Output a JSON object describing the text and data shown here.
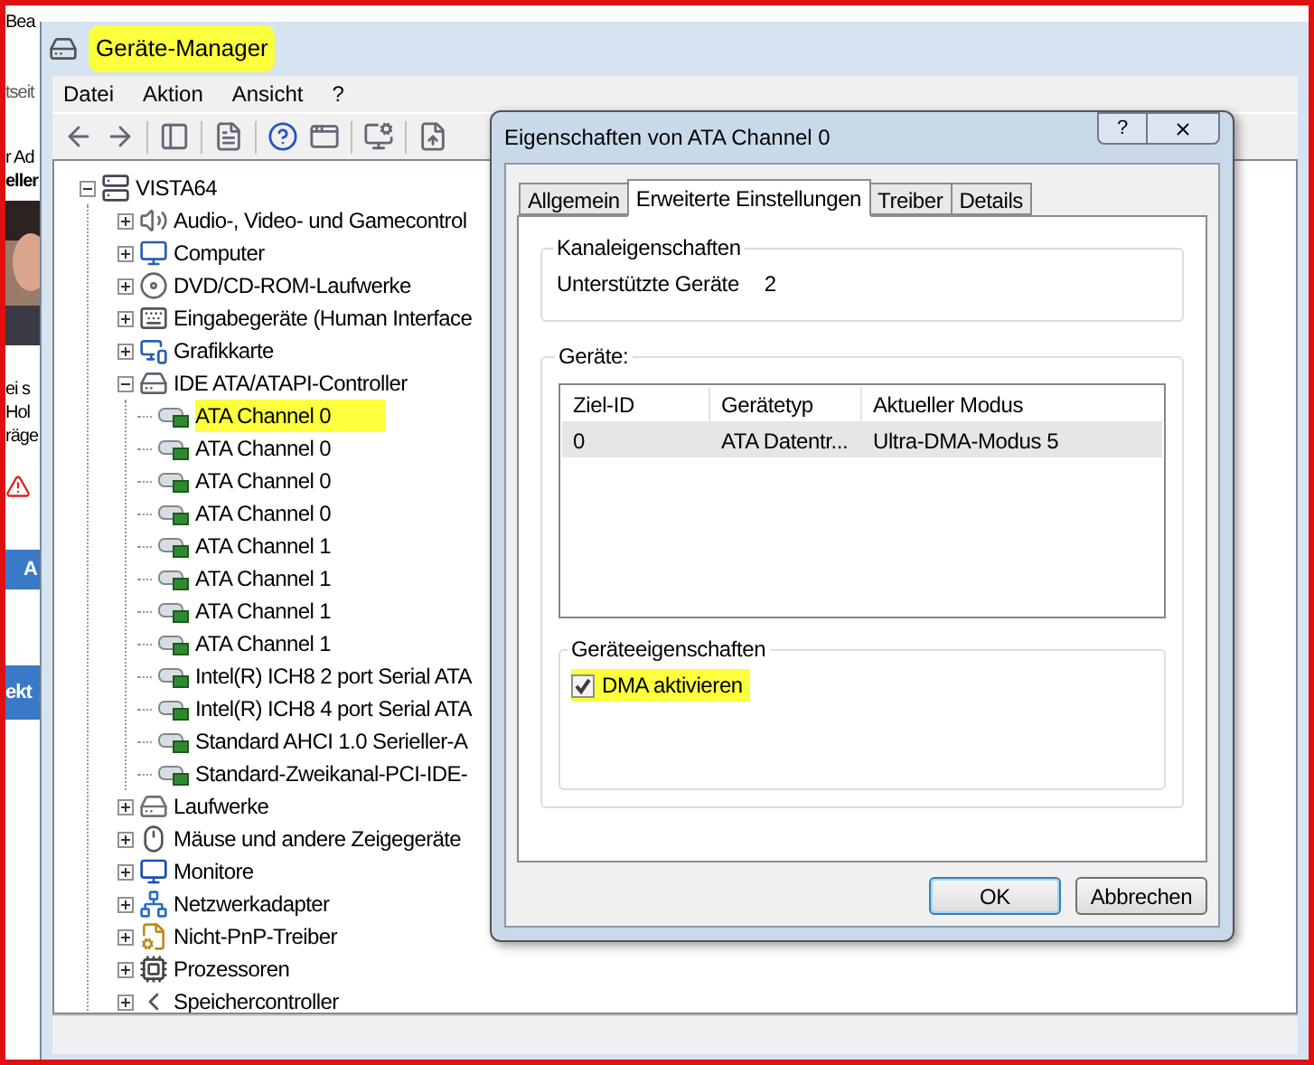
{
  "background_window": {
    "fragments": [
      "Bea",
      "tseit",
      "r Ad",
      "eller",
      "ei s",
      "Hol",
      "räge"
    ],
    "buttons": [
      "A",
      "ekt"
    ]
  },
  "window": {
    "title": "Geräte-Manager",
    "title_highlighted": true
  },
  "menu": [
    "Datei",
    "Aktion",
    "Ansicht",
    "?"
  ],
  "tree": {
    "label": "VISTA64",
    "expanded": true,
    "children": [
      {
        "label": "Audio-, Video- und Gamecontrol",
        "expanded": false
      },
      {
        "label": "Computer",
        "expanded": false
      },
      {
        "label": "DVD/CD-ROM-Laufwerke",
        "expanded": false
      },
      {
        "label": "Eingabegeräte (Human Interface",
        "expanded": false
      },
      {
        "label": "Grafikkarte",
        "expanded": false
      },
      {
        "label": "IDE ATA/ATAPI-Controller",
        "expanded": true,
        "children": [
          {
            "label": "ATA Channel 0",
            "highlighted": true
          },
          {
            "label": "ATA Channel 0",
            "highlighted": false
          },
          {
            "label": "ATA Channel 0",
            "highlighted": false
          },
          {
            "label": "ATA Channel 0",
            "highlighted": false
          },
          {
            "label": "ATA Channel 1",
            "highlighted": false
          },
          {
            "label": "ATA Channel 1",
            "highlighted": false
          },
          {
            "label": "ATA Channel 1",
            "highlighted": false
          },
          {
            "label": "ATA Channel 1",
            "highlighted": false
          },
          {
            "label": "Intel(R) ICH8 2 port Serial ATA",
            "highlighted": false
          },
          {
            "label": "Intel(R) ICH8 4 port Serial ATA",
            "highlighted": false
          },
          {
            "label": "Standard AHCI 1.0 Serieller-A",
            "highlighted": false
          },
          {
            "label": "Standard-Zweikanal-PCI-IDE-",
            "highlighted": false
          }
        ]
      },
      {
        "label": "Laufwerke",
        "expanded": false
      },
      {
        "label": "Mäuse und andere Zeigegeräte",
        "expanded": false
      },
      {
        "label": "Monitore",
        "expanded": false
      },
      {
        "label": "Netzwerkadapter",
        "expanded": false
      },
      {
        "label": "Nicht-PnP-Treiber",
        "expanded": false
      },
      {
        "label": "Prozessoren",
        "expanded": false
      },
      {
        "label": "Speichercontroller",
        "expanded": false
      }
    ]
  },
  "dialog": {
    "title": "Eigenschaften von ATA Channel 0",
    "help_button": "?",
    "tabs": [
      {
        "label": "Allgemein",
        "selected": false
      },
      {
        "label": "Erweiterte Einstellungen",
        "selected": true
      },
      {
        "label": "Treiber",
        "selected": false
      },
      {
        "label": "Details",
        "selected": false
      }
    ],
    "channel_group": {
      "title": "Kanaleigenschaften",
      "label": "Unterstützte Geräte",
      "value": "2"
    },
    "devices_group": {
      "title": "Geräte:",
      "columns": [
        "Ziel-ID",
        "Gerätetyp",
        "Aktueller Modus"
      ],
      "rows": [
        {
          "cells": [
            "0",
            "ATA Datentr...",
            "Ultra-DMA-Modus 5"
          ],
          "selected": true
        }
      ],
      "properties_group": {
        "title": "Geräteeigenschaften",
        "checkbox": {
          "label": "DMA aktivieren",
          "checked": true,
          "highlighted": true
        }
      }
    },
    "buttons": [
      {
        "label": "OK",
        "default": true
      },
      {
        "label": "Abbrechen",
        "default": false
      }
    ]
  }
}
